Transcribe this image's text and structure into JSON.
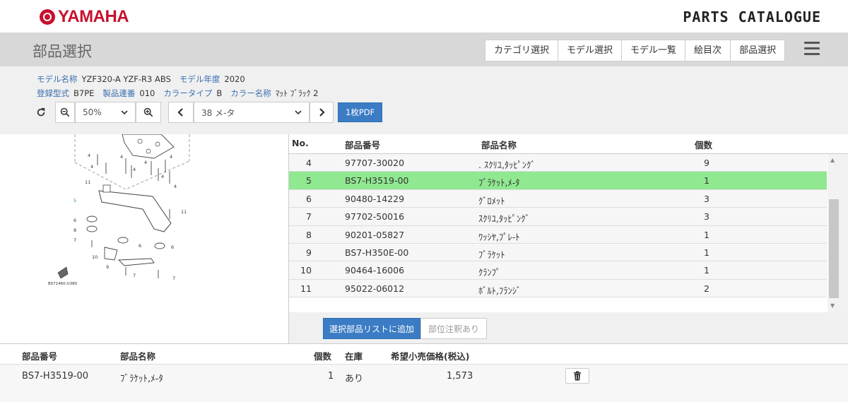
{
  "brand": {
    "name": "YAMAHA",
    "catalog": "PARTS CATALOGUE"
  },
  "header": {
    "title": "部品選択",
    "tabs": [
      "カテゴリ選択",
      "モデル選択",
      "モデル一覧",
      "絵目次",
      "部品選択"
    ]
  },
  "info": {
    "model_name_label": "モデル名称",
    "model_name": "YZF320-A YZF-R3 ABS",
    "model_year_label": "モデル年度",
    "model_year": "2020",
    "reg_type_label": "登録型式",
    "reg_type": "B7PE",
    "serial_label": "製品連番",
    "serial": "010",
    "color_type_label": "カラータイプ",
    "color_type": "B",
    "color_name_label": "カラー名称",
    "color_name": "ﾏｯﾄ ﾌﾞﾗｯｸ 2"
  },
  "controls": {
    "zoom": "50%",
    "figure": "38 メ-タ",
    "pdf_label": "1枚PDF"
  },
  "parts_table": {
    "headers": {
      "no": "No.",
      "part_number": "部品番号",
      "part_name": "部品名称",
      "qty": "個数"
    },
    "rows": [
      {
        "no": "4",
        "part_number": "97707-30020",
        "part_name": ". ｽｸﾘﾕ,ﾀｯﾋﾟﾝｸﾞ",
        "qty": "9"
      },
      {
        "no": "5",
        "part_number": "BS7-H3519-00",
        "part_name": "ﾌﾞﾗｹｯﾄ,ﾒ-ﾀ",
        "qty": "1",
        "selected": true
      },
      {
        "no": "6",
        "part_number": "90480-14229",
        "part_name": "ｸﾞﾛﾒｯﾄ",
        "qty": "3"
      },
      {
        "no": "7",
        "part_number": "97702-50016",
        "part_name": "ｽｸﾘﾕ,ﾀｯﾋﾟﾝｸﾞ",
        "qty": "3"
      },
      {
        "no": "8",
        "part_number": "90201-05827",
        "part_name": "ﾜｯｼﾔ,ﾌﾟﾚ-ﾄ",
        "qty": "1"
      },
      {
        "no": "9",
        "part_number": "BS7-H350E-00",
        "part_name": "ﾌﾞﾗｹｯﾄ",
        "qty": "1"
      },
      {
        "no": "10",
        "part_number": "90464-16006",
        "part_name": "ｸﾗﾝﾌﾟ",
        "qty": "1"
      },
      {
        "no": "11",
        "part_number": "95022-06012",
        "part_name": "ﾎﾞﾙﾄ,ﾌﾗﾝｼﾞ",
        "qty": "2"
      }
    ],
    "add_button": "選択部品リストに追加",
    "note_button": "部位注釈あり"
  },
  "diagram": {
    "code": "BS71460-U380",
    "labels": [
      "4",
      "4",
      "4",
      "4",
      "4",
      "4",
      "4",
      "4",
      "11",
      "5",
      "11",
      "6",
      "8",
      "7",
      "6",
      "6",
      "10",
      "9",
      "7",
      "7"
    ]
  },
  "selection": {
    "headers": {
      "part_number": "部品番号",
      "part_name": "部品名称",
      "qty": "個数",
      "stock": "在庫",
      "price": "希望小売価格(税込)"
    },
    "row": {
      "part_number": "BS7-H3519-00",
      "part_name": "ﾌﾞﾗｹｯﾄ,ﾒ-ﾀ",
      "qty": "1",
      "stock": "あり",
      "price": "1,573"
    }
  }
}
